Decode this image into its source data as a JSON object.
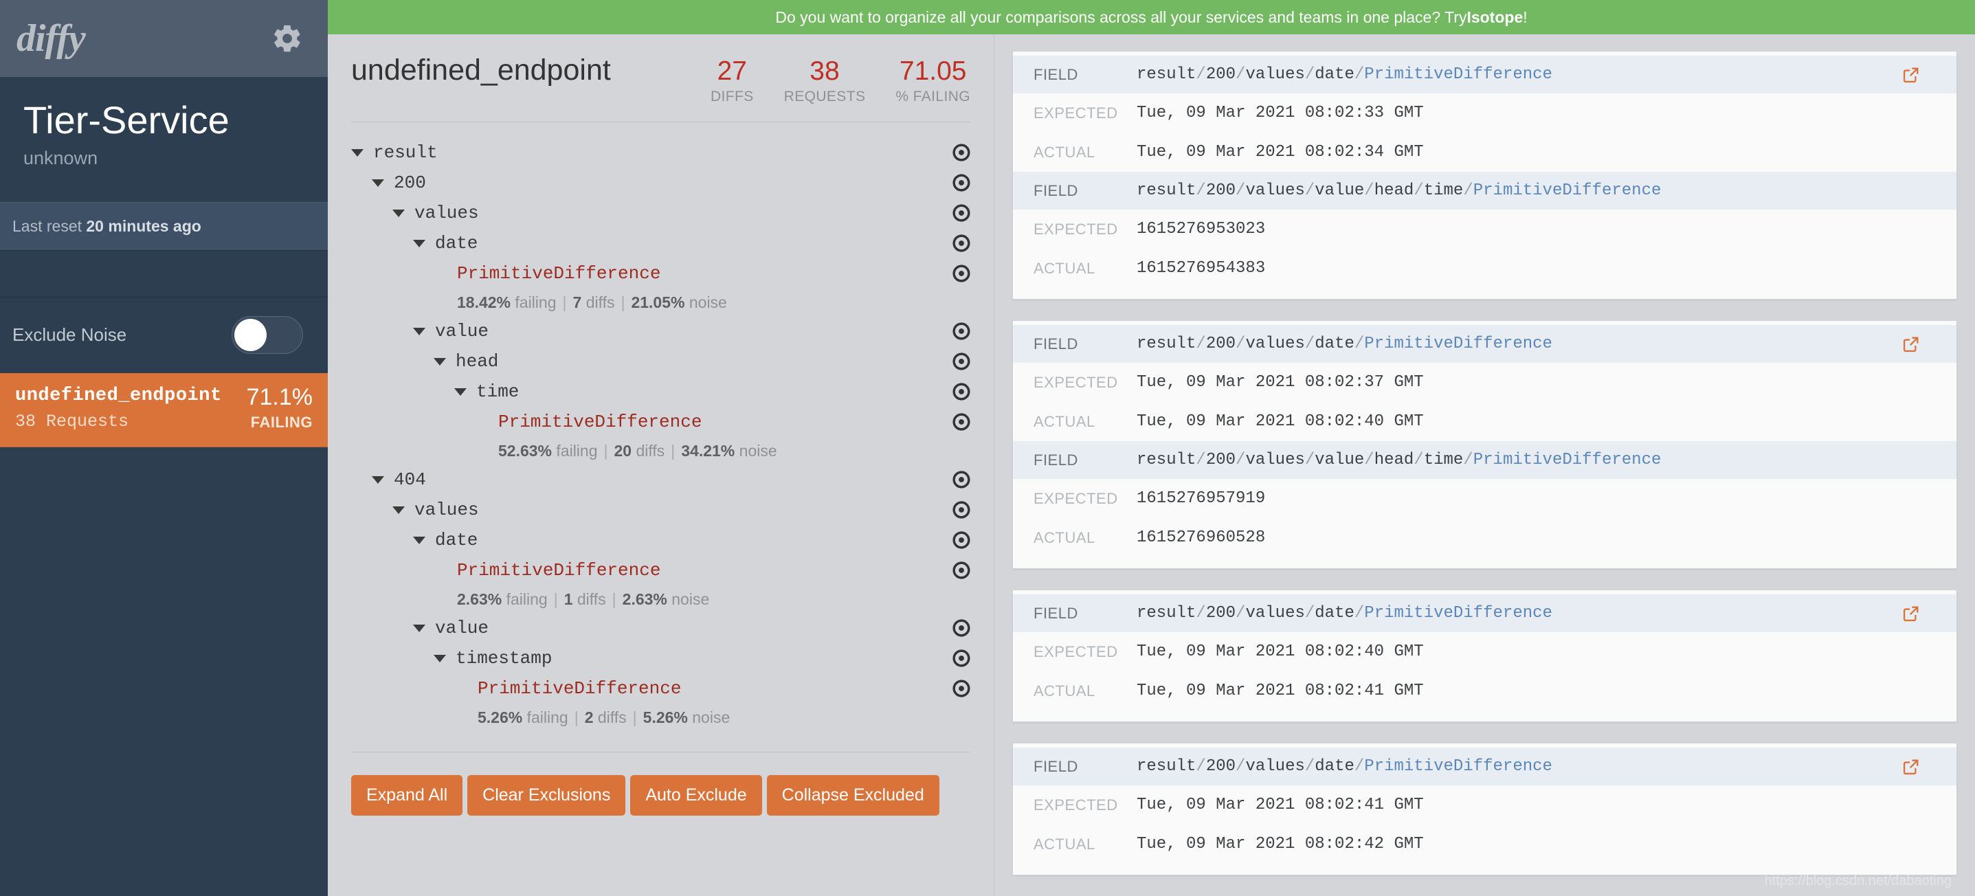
{
  "sidebar": {
    "logo_text": "diffy",
    "gear_icon": "gear-icon",
    "service_name": "Tier-Service",
    "service_sub": "unknown",
    "last_reset_prefix": "Last reset",
    "last_reset_value": "20 minutes ago",
    "exclude_noise_label": "Exclude Noise",
    "exclude_noise_on": false,
    "endpoint": {
      "name": "undefined_endpoint",
      "requests": "38 Requests",
      "percent": "71.1%",
      "status": "FAILING"
    },
    "colors": {
      "bg": "#2d3e50",
      "topbar": "#4f5d6e",
      "accent": "#d9733a"
    }
  },
  "banner": {
    "text_before": "Do you want to organize all your comparisons across all your services and teams in one place? Try ",
    "link_text": "Isotope",
    "text_after": "!",
    "color": "#73b961"
  },
  "header": {
    "title": "undefined_endpoint",
    "stats": [
      {
        "value": "27",
        "label": "DIFFS"
      },
      {
        "value": "38",
        "label": "REQUESTS"
      },
      {
        "value": "71.05",
        "label": "% FAILING"
      }
    ],
    "stat_color": "#bf2f23"
  },
  "tree": {
    "target_icon": "target-icon",
    "rows": [
      {
        "label": "result",
        "depth": 0,
        "type": "node"
      },
      {
        "label": "200",
        "depth": 1,
        "type": "node"
      },
      {
        "label": "values",
        "depth": 2,
        "type": "node"
      },
      {
        "label": "date",
        "depth": 3,
        "type": "node"
      },
      {
        "label": "PrimitiveDifference",
        "depth": 4,
        "type": "diff"
      },
      {
        "failing": "18.42%",
        "diffs": "7",
        "noise": "21.05%",
        "depth": 4,
        "type": "meta"
      },
      {
        "label": "value",
        "depth": 3,
        "type": "node"
      },
      {
        "label": "head",
        "depth": 4,
        "type": "node"
      },
      {
        "label": "time",
        "depth": 5,
        "type": "node"
      },
      {
        "label": "PrimitiveDifference",
        "depth": 6,
        "type": "diff"
      },
      {
        "failing": "52.63%",
        "diffs": "20",
        "noise": "34.21%",
        "depth": 6,
        "type": "meta"
      },
      {
        "label": "404",
        "depth": 1,
        "type": "node"
      },
      {
        "label": "values",
        "depth": 2,
        "type": "node"
      },
      {
        "label": "date",
        "depth": 3,
        "type": "node"
      },
      {
        "label": "PrimitiveDifference",
        "depth": 4,
        "type": "diff"
      },
      {
        "failing": "2.63%",
        "diffs": "1",
        "noise": "2.63%",
        "depth": 4,
        "type": "meta"
      },
      {
        "label": "value",
        "depth": 3,
        "type": "node"
      },
      {
        "label": "timestamp",
        "depth": 4,
        "type": "node"
      },
      {
        "label": "PrimitiveDifference",
        "depth": 5,
        "type": "diff"
      },
      {
        "failing": "5.26%",
        "diffs": "2",
        "noise": "5.26%",
        "depth": 5,
        "type": "meta"
      }
    ],
    "meta_words": {
      "failing": "failing",
      "diffs": "diffs",
      "noise": "noise"
    }
  },
  "buttons": [
    {
      "label": "Expand All",
      "name": "expand-all-button"
    },
    {
      "label": "Clear Exclusions",
      "name": "clear-exclusions-button"
    },
    {
      "label": "Auto Exclude",
      "name": "auto-exclude-button"
    },
    {
      "label": "Collapse Excluded",
      "name": "collapse-excluded-button"
    }
  ],
  "diff_labels": {
    "field": "FIELD",
    "expected": "EXPECTED",
    "actual": "ACTUAL"
  },
  "cards": [
    {
      "ext_icon": "external-link-icon",
      "entries": [
        {
          "field_path": "result/200/values/date/",
          "field_leaf": "PrimitiveDifference",
          "expected": "Tue, 09 Mar 2021 08:02:33 GMT",
          "actual": "Tue, 09 Mar 2021 08:02:34 GMT"
        },
        {
          "field_path": "result/200/values/value/head/time/",
          "field_leaf": "PrimitiveDifference",
          "expected": "1615276953023",
          "actual": "1615276954383"
        }
      ]
    },
    {
      "ext_icon": "external-link-icon",
      "entries": [
        {
          "field_path": "result/200/values/date/",
          "field_leaf": "PrimitiveDifference",
          "expected": "Tue, 09 Mar 2021 08:02:37 GMT",
          "actual": "Tue, 09 Mar 2021 08:02:40 GMT"
        },
        {
          "field_path": "result/200/values/value/head/time/",
          "field_leaf": "PrimitiveDifference",
          "expected": "1615276957919",
          "actual": "1615276960528"
        }
      ]
    },
    {
      "ext_icon": "external-link-icon",
      "entries": [
        {
          "field_path": "result/200/values/date/",
          "field_leaf": "PrimitiveDifference",
          "expected": "Tue, 09 Mar 2021 08:02:40 GMT",
          "actual": "Tue, 09 Mar 2021 08:02:41 GMT"
        }
      ]
    },
    {
      "ext_icon": "external-link-icon",
      "entries": [
        {
          "field_path": "result/200/values/date/",
          "field_leaf": "PrimitiveDifference",
          "expected": "Tue, 09 Mar 2021 08:02:41 GMT",
          "actual": "Tue, 09 Mar 2021 08:02:42 GMT"
        }
      ]
    }
  ],
  "watermark": "https://blog.csdn.net/dabaoting"
}
